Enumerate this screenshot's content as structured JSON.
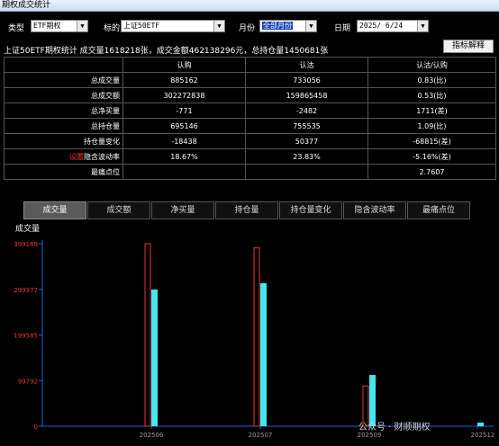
{
  "window": {
    "title": "期权成交统计"
  },
  "filters": {
    "type_label": "类型",
    "type_value": "ETF期权",
    "underlying_label": "标的",
    "underlying_value": "上证50ETF",
    "month_label": "月份",
    "month_value": "全部月份",
    "date_label": "日期",
    "date_value": "2025/ 6/24"
  },
  "summary": "上证50ETF期权统计 成交量1618218张，成交金额462138296元，总持仓量1450681张",
  "explain_button": "指标解释",
  "table": {
    "headers": [
      "",
      "认购",
      "认沽",
      "认沽/认购"
    ],
    "rows": [
      {
        "label": "总成交量",
        "call": "885162",
        "put": "733056",
        "ratio": "0.83(比)"
      },
      {
        "label": "总成交额",
        "call": "302272838",
        "put": "159865458",
        "ratio": "0.53(比)"
      },
      {
        "label": "总净买量",
        "call": "-771",
        "put": "-2482",
        "ratio": "1711(差)"
      },
      {
        "label": "总持仓量",
        "call": "695146",
        "put": "755535",
        "ratio": "1.09(比)"
      },
      {
        "label": "持仓量变化",
        "call": "-18438",
        "put": "50377",
        "ratio": "-68815(差)"
      },
      {
        "label": "隐含波动率",
        "prefix": "设置",
        "call": "18.67%",
        "put": "23.83%",
        "ratio": "-5.16%(差)"
      },
      {
        "label": "最痛点位",
        "call": "",
        "put": "",
        "ratio": "2.7607"
      }
    ]
  },
  "tabs": [
    "成交量",
    "成交额",
    "净买量",
    "持仓量",
    "持仓量变化",
    "隐含波动率",
    "最痛点位"
  ],
  "active_tab": "成交量",
  "watermark": "公众号 · 财顺期权",
  "colors": {
    "call_bar": "#e8392d",
    "put_bar": "#40e8f2",
    "axis_label": "#e8392d",
    "axis": "#2a5bd8"
  },
  "chart_data": {
    "type": "bar",
    "title": "成交量",
    "categories": [
      "202506",
      "202507",
      "202509",
      "202512"
    ],
    "series": [
      {
        "values": [
          399169,
          390000,
          88000,
          0
        ]
      },
      {
        "values": [
          299000,
          313000,
          112000,
          8000
        ]
      }
    ],
    "yticks": [
      "0",
      "99792",
      "199585",
      "299377",
      "399169"
    ],
    "ylim": [
      0,
      399169
    ]
  }
}
